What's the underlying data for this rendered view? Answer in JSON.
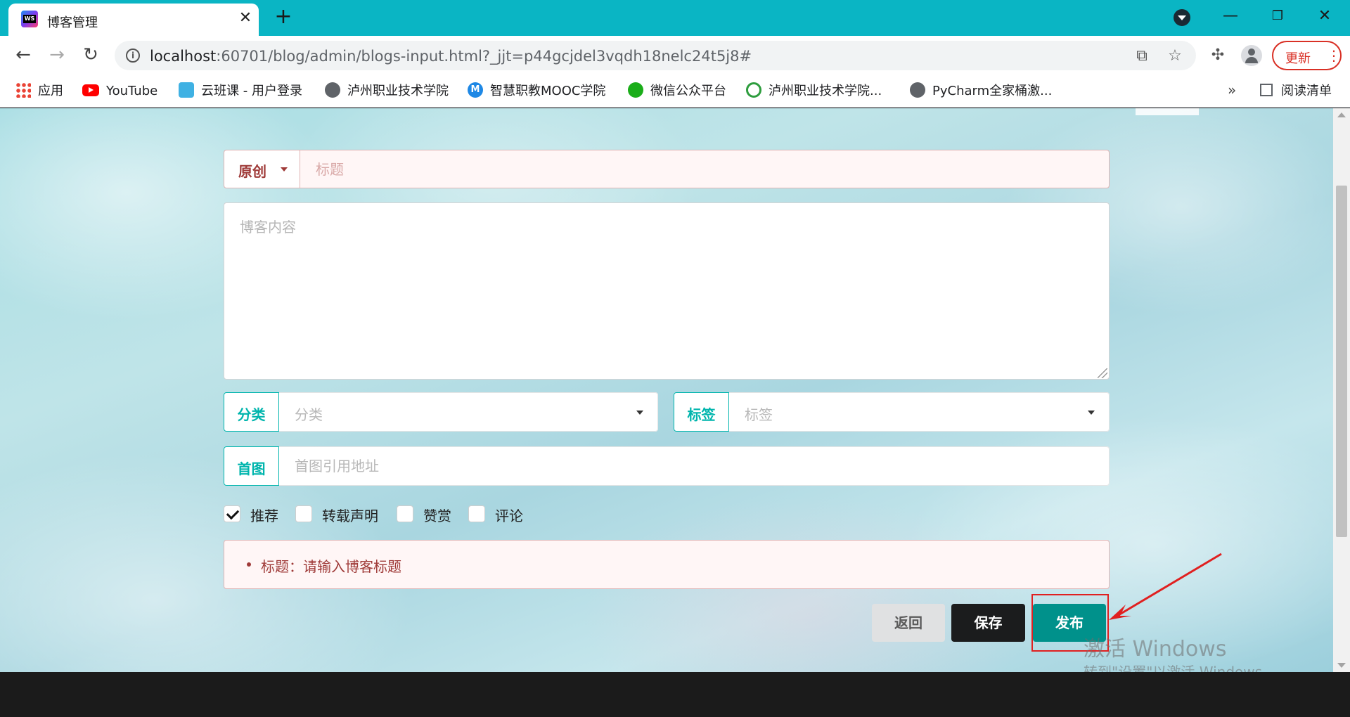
{
  "browser": {
    "tab_title": "博客管理",
    "url_host": "localhost",
    "url_rest": ":60701/blog/admin/blogs-input.html?_jjt=p44gcjdel3vqdh18nelc24t5j8#",
    "update_label": "更新",
    "bookmarks": [
      {
        "label": "应用",
        "icon": "apps-icon"
      },
      {
        "label": "YouTube",
        "icon": "youtube-icon"
      },
      {
        "label": "云班课 - 用户登录",
        "icon": "cloud-icon"
      },
      {
        "label": "泸州职业技术学院",
        "icon": "globe-icon"
      },
      {
        "label": "智慧职教MOOC学院",
        "icon": "mooc-icon"
      },
      {
        "label": "微信公众平台",
        "icon": "wechat-icon"
      },
      {
        "label": "泸州职业技术学院...",
        "icon": "dna-icon"
      },
      {
        "label": "PyCharm全家桶激...",
        "icon": "globe-icon"
      }
    ],
    "more_bookmarks": "»",
    "reading_list": "阅读清单"
  },
  "form": {
    "type_dropdown": "原创",
    "title_placeholder": "标题",
    "content_placeholder": "博客内容",
    "category_label": "分类",
    "category_placeholder": "分类",
    "tag_label": "标签",
    "tag_placeholder": "标签",
    "cover_label": "首图",
    "cover_placeholder": "首图引用地址",
    "checkboxes": [
      {
        "label": "推荐",
        "checked": true
      },
      {
        "label": "转载声明",
        "checked": false
      },
      {
        "label": "赞赏",
        "checked": false
      },
      {
        "label": "评论",
        "checked": false
      }
    ],
    "error_message": "标题：请输入博客标题",
    "buttons": {
      "back": "返回",
      "save": "保存",
      "publish": "发布"
    }
  },
  "watermark": {
    "line1": "激活 Windows",
    "line2": "转到\"设置\"以激活 Windows。"
  },
  "colors": {
    "teal_accent": "#00b5ad",
    "error_red": "#9f3a38",
    "publish_button": "#00918b",
    "chrome_bar": "#0ab5c4"
  }
}
